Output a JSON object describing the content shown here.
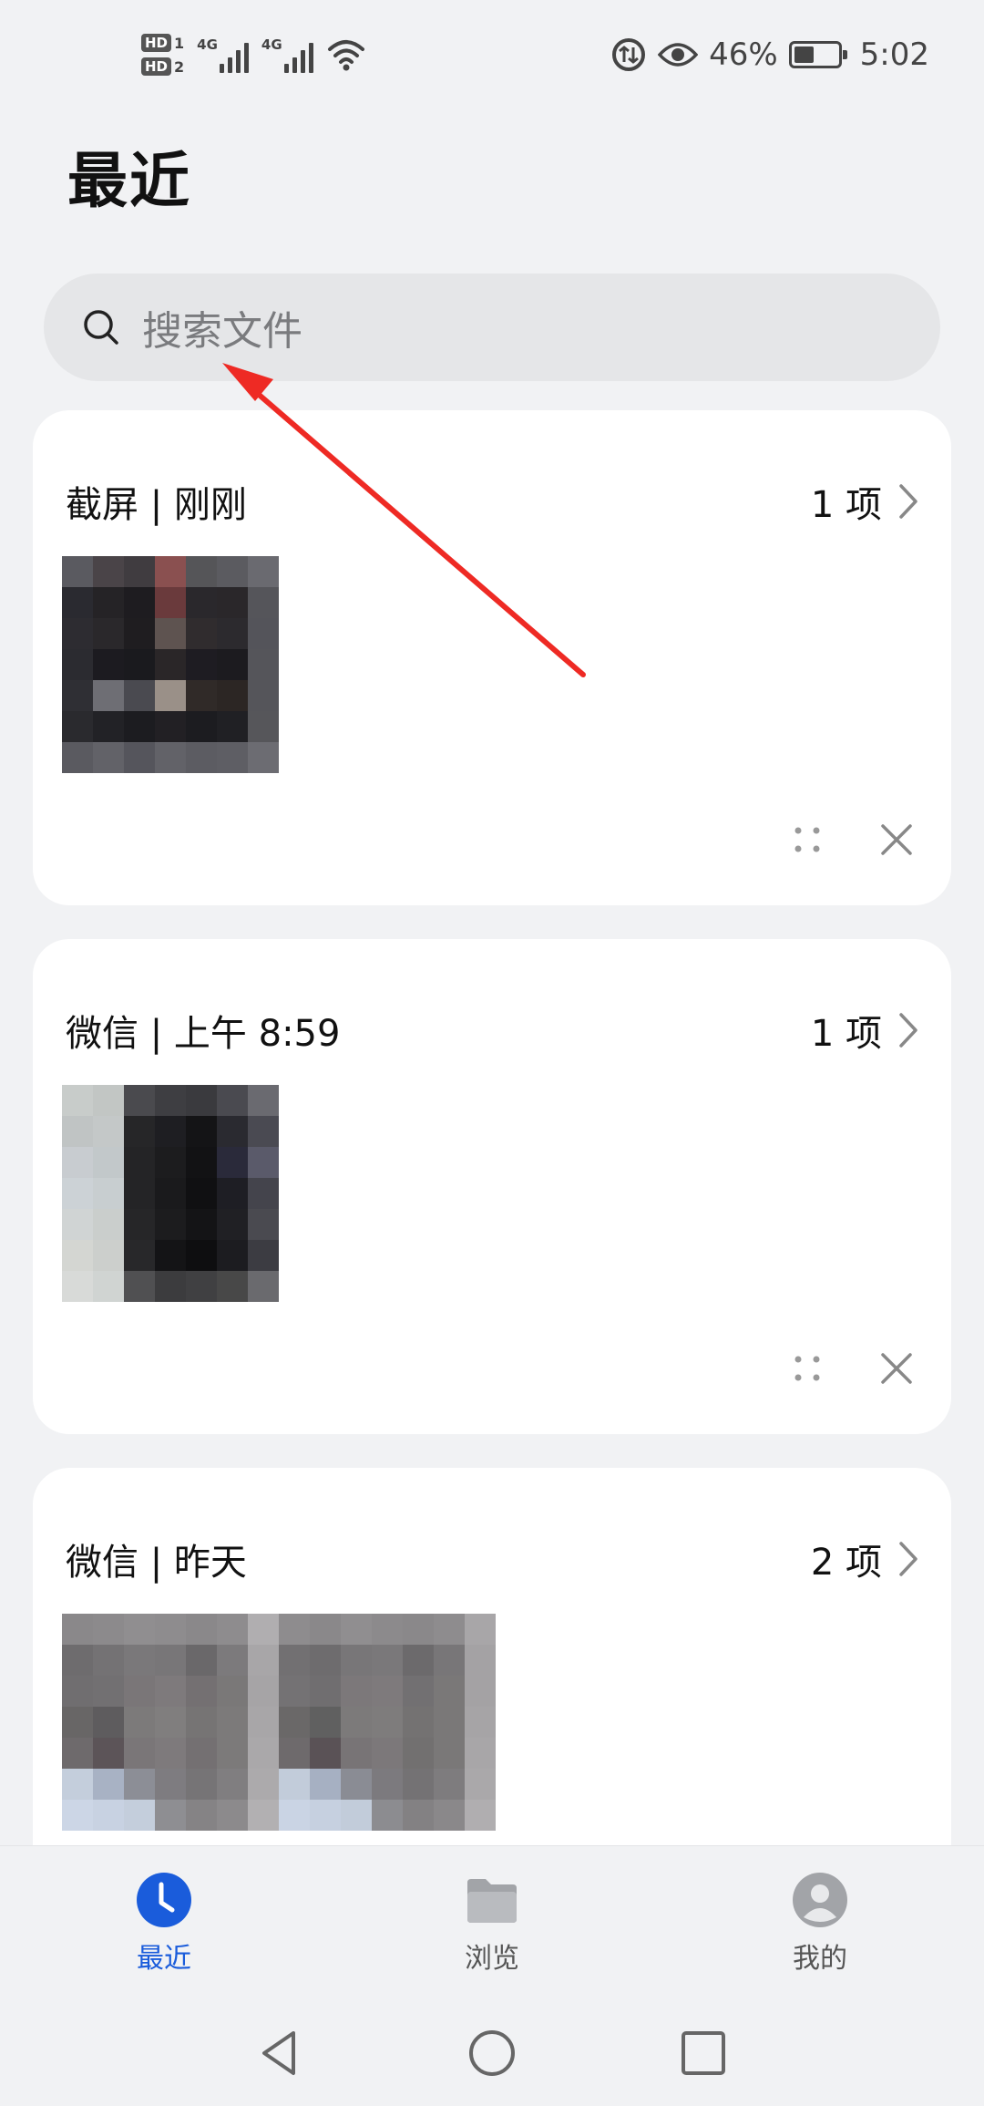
{
  "status_bar": {
    "sim1_label": "HD",
    "sim1_num": "1",
    "sim2_label": "HD",
    "sim2_num": "2",
    "network1": "4G",
    "network2": "4G",
    "battery_percent": "46%",
    "battery_level": 0.46,
    "time": "5:02"
  },
  "page_title": "最近",
  "search": {
    "placeholder": "搜索文件"
  },
  "groups": [
    {
      "title": "截屏 | 刚刚",
      "count": "1 项"
    },
    {
      "title": "微信 | 上午 8:59",
      "count": "1 项"
    },
    {
      "title": "微信 | 昨天",
      "count": "2 项"
    }
  ],
  "bottom_nav": {
    "items": [
      {
        "label": "最近",
        "active": true
      },
      {
        "label": "浏览",
        "active": false
      },
      {
        "label": "我的",
        "active": false
      }
    ]
  },
  "colors": {
    "accent": "#1a5cdb",
    "background": "#f1f2f4",
    "annotation_arrow": "#ee2a24"
  }
}
